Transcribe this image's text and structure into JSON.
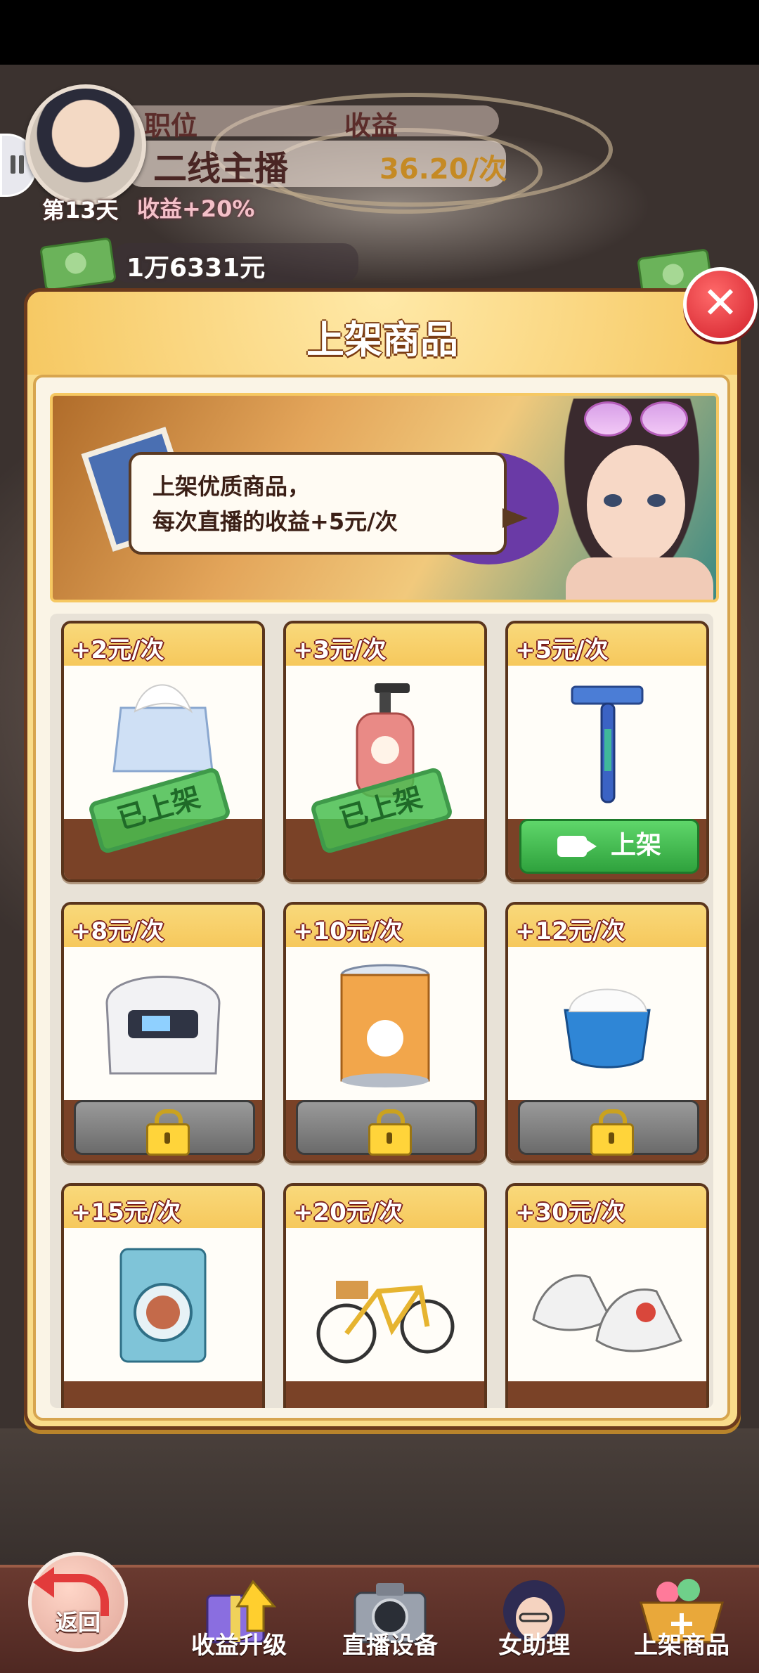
{
  "player": {
    "job_label": "职位",
    "job_value": "二线主播",
    "income_label": "收益",
    "income_value": "36.20/次",
    "day": "第13天",
    "bonus": "收益+20%",
    "money": "1万6331元"
  },
  "modal": {
    "title": "上架商品",
    "close_icon": "close-x-icon",
    "bubble_line1": "上架优质商品，",
    "bubble_line2": "每次直播的收益+5元/次"
  },
  "products": [
    {
      "price": "+2元/次",
      "item": "tissue-box",
      "status": "listed",
      "stamp": "已上架"
    },
    {
      "price": "+3元/次",
      "item": "lotion-bottle",
      "status": "listed",
      "stamp": "已上架"
    },
    {
      "price": "+5元/次",
      "item": "razor",
      "status": "available",
      "button": "上架"
    },
    {
      "price": "+8元/次",
      "item": "rice-cooker",
      "status": "locked"
    },
    {
      "price": "+10元/次",
      "item": "milk-powder",
      "status": "locked"
    },
    {
      "price": "+12元/次",
      "item": "face-cream",
      "status": "locked"
    },
    {
      "price": "+15元/次",
      "item": "washing-machine",
      "status": "locked"
    },
    {
      "price": "+20元/次",
      "item": "bicycle",
      "status": "locked"
    },
    {
      "price": "+30元/次",
      "item": "sneakers",
      "status": "locked"
    }
  ],
  "nav": {
    "back": "返回",
    "items": [
      "收益升级",
      "直播设备",
      "女助理",
      "上架商品"
    ]
  },
  "colors": {
    "modal_bg": "#f9dc8a",
    "card_bottom": "#7a4227",
    "green_button": "#2fa23d",
    "close_red": "#d21f2a"
  }
}
